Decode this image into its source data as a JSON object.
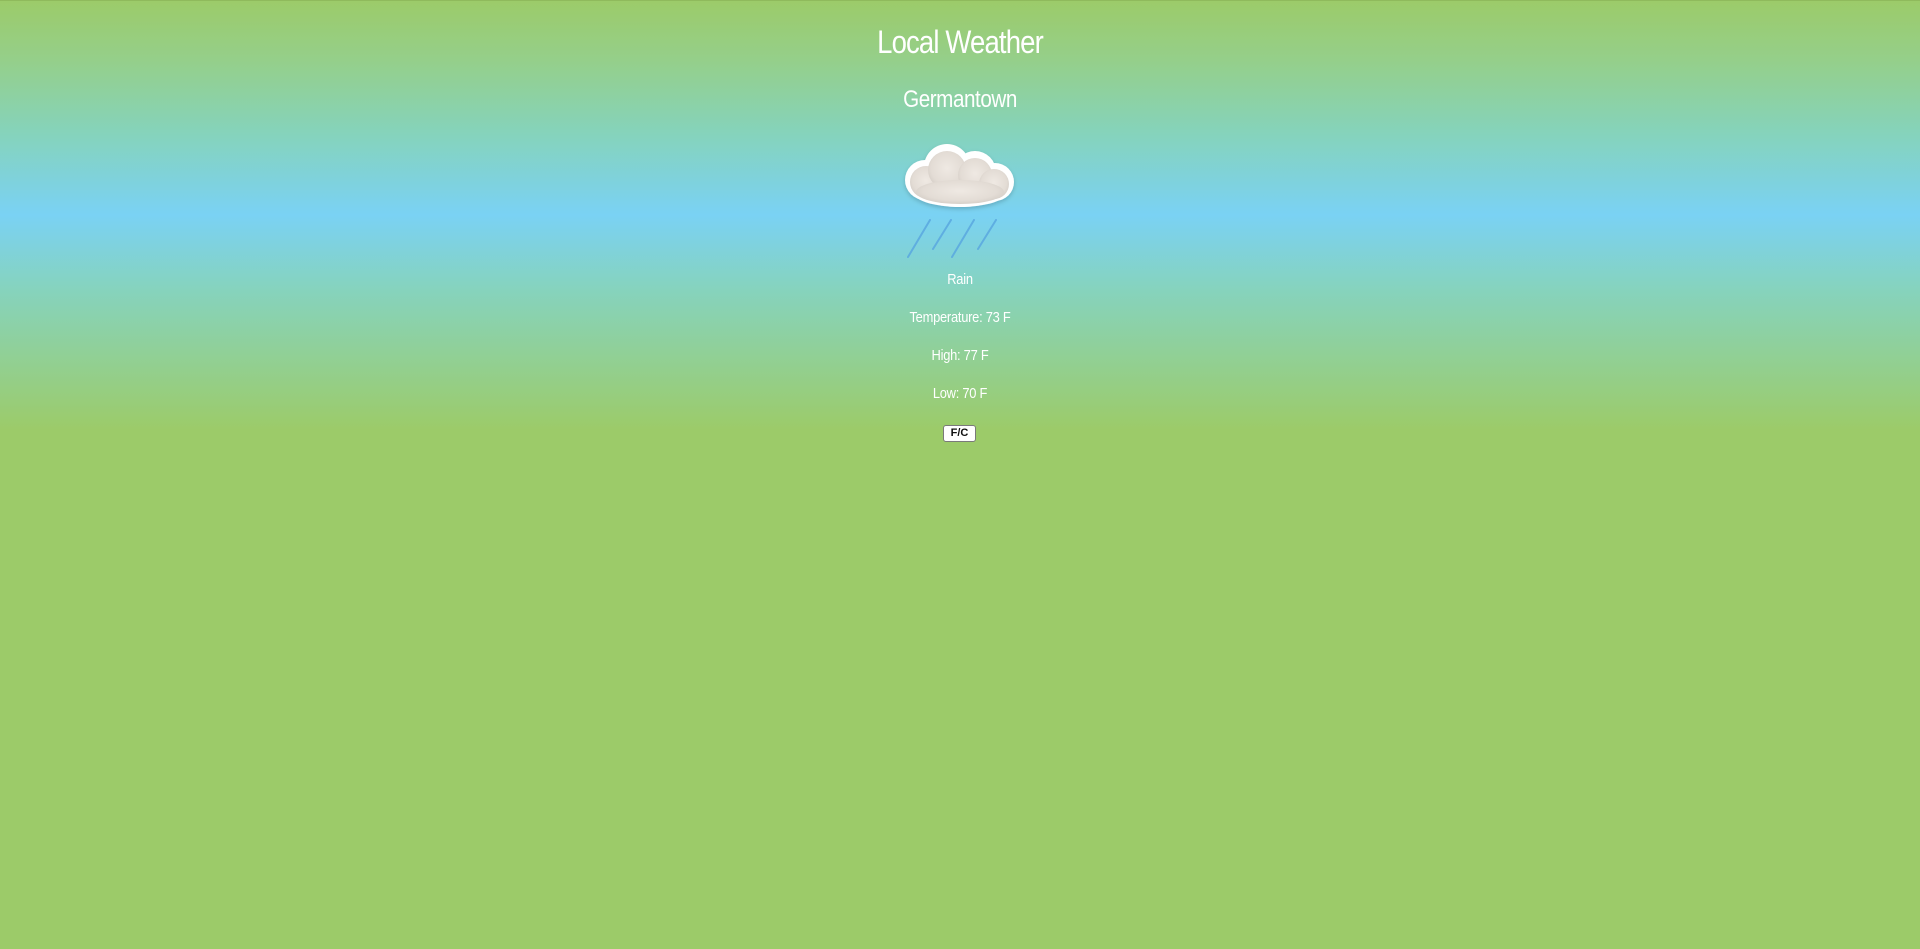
{
  "header": {
    "title": "Local Weather"
  },
  "location": {
    "city": "Germantown"
  },
  "weather": {
    "icon": "rain-cloud-icon",
    "description": "Rain",
    "temperature": "Temperature: 73 F",
    "high": "High: 77 F",
    "low": "Low: 70 F"
  },
  "controls": {
    "unit_toggle_label": "F/C"
  },
  "colors": {
    "background_green": "#9ccb69",
    "background_blue": "#7ad2f4",
    "text": "#ffffff",
    "rain": "#5aa8e0",
    "cloud": "#e8e2dc"
  }
}
